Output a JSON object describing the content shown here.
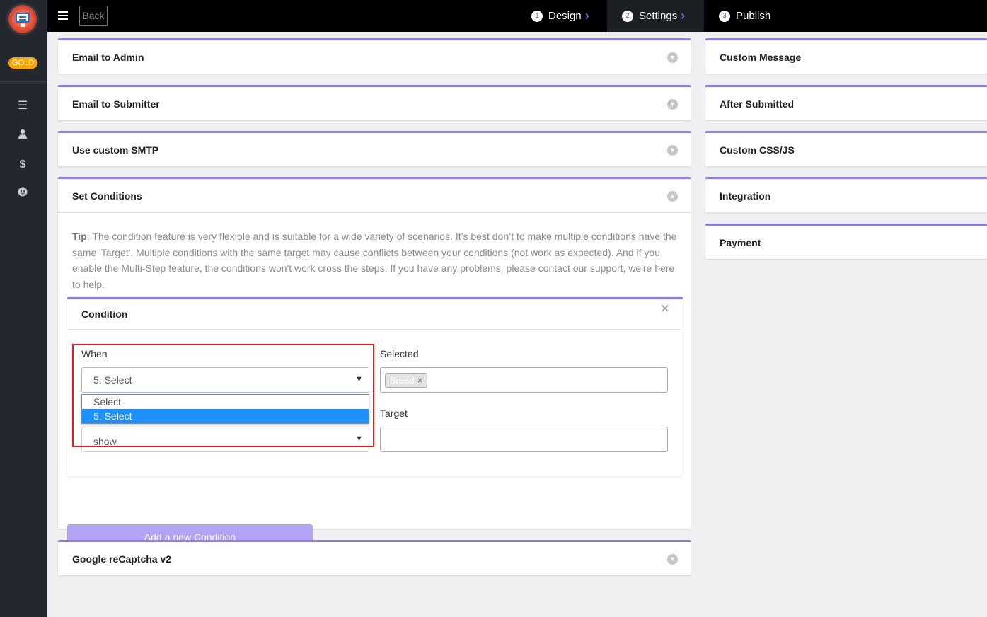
{
  "sidebar": {
    "badge": "GOLD",
    "icons": [
      "list-icon",
      "user-icon",
      "dollar-icon",
      "smiley-icon"
    ]
  },
  "topbar": {
    "back_label": "Back",
    "steps": [
      {
        "num": "1",
        "label": "Design"
      },
      {
        "num": "2",
        "label": "Settings"
      },
      {
        "num": "3",
        "label": "Publish"
      }
    ]
  },
  "left_panels": {
    "email_admin": "Email to Admin",
    "email_submitter": "Email to Submitter",
    "custom_smtp": "Use custom SMTP",
    "set_conditions": "Set Conditions",
    "recaptcha": "Google reCaptcha v2"
  },
  "right_panels": {
    "custom_message": "Custom Message",
    "after_submitted": "After Submitted",
    "custom_css_js": "Custom CSS/JS",
    "integration": "Integration",
    "payment": "Payment"
  },
  "conditions": {
    "tip_label": "Tip",
    "tip_text": ": The condition feature is very flexible and is suitable for a wide variety of scenarios. It’s best don’t to make multiple conditions have the same 'Target'. Multiple conditions with the same target may cause conflicts between your conditions (not work as expected). And if you enable the Multi-Step feature, the conditions won't work cross the steps. If you have any problems, please contact our support, we're here to help.",
    "condition_title": "Condition",
    "when_label": "When",
    "when_value": "5. Select",
    "when_options": [
      "Select",
      "5. Select"
    ],
    "action_value": "show",
    "selected_label": "Selected",
    "selected_tag": "Bread",
    "target_label": "Target",
    "add_button": "Add a new Condition"
  }
}
